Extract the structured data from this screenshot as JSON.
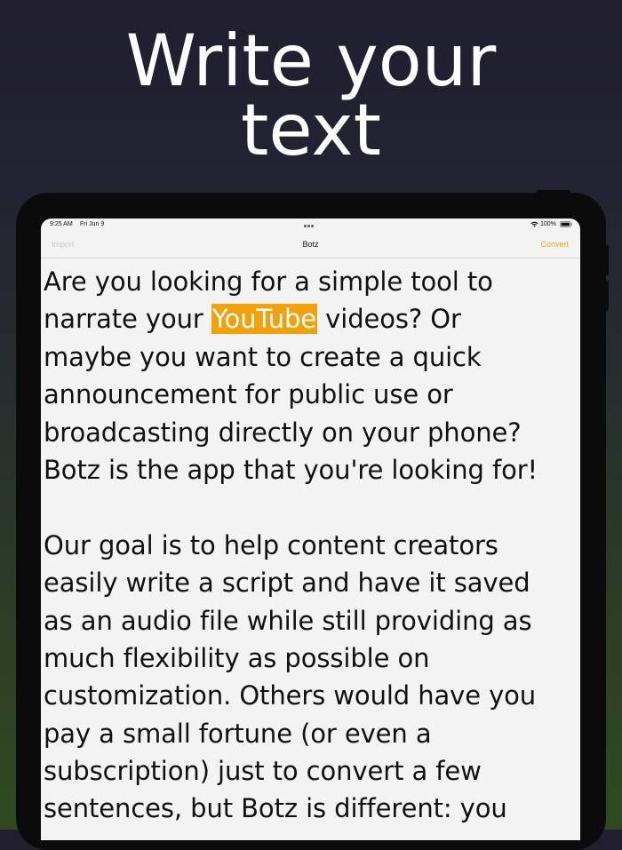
{
  "headline": {
    "line1": "Write your",
    "line2": "text"
  },
  "status_bar": {
    "time": "9:25 AM",
    "date": "Fri Jun 9",
    "battery_percent": "100%",
    "icons": [
      "multitask-dots-icon",
      "wifi-icon",
      "battery-icon"
    ]
  },
  "nav_bar": {
    "left_button": "Import",
    "title": "Botz",
    "right_button": "Convert"
  },
  "editor": {
    "paragraph1": {
      "line1": "Are you looking for a simple tool to",
      "line2_before": "narrate your ",
      "line2_highlight": "YouTube",
      "line2_after": " videos? Or",
      "line3": "maybe you want to create a quick",
      "line4": "announcement for public use or",
      "line5": "broadcasting directly on your phone?",
      "line6": "Botz is the app that you're looking for!"
    },
    "paragraph2": {
      "line1": "Our goal is to help content creators",
      "line2": "easily write a script and have it saved",
      "line3": "as an audio file while still providing as",
      "line4": "much flexibility as possible on",
      "line5": "customization. Others would have you",
      "line6": "pay a small fortune (or even a",
      "line7": "subscription) just to convert a few",
      "line8": "sentences, but Botz is different: you"
    }
  },
  "colors": {
    "accent": "#f2a10a",
    "disabled": "#c8c8cc",
    "screen_background": "#f3f3f4",
    "text": "#111111"
  }
}
